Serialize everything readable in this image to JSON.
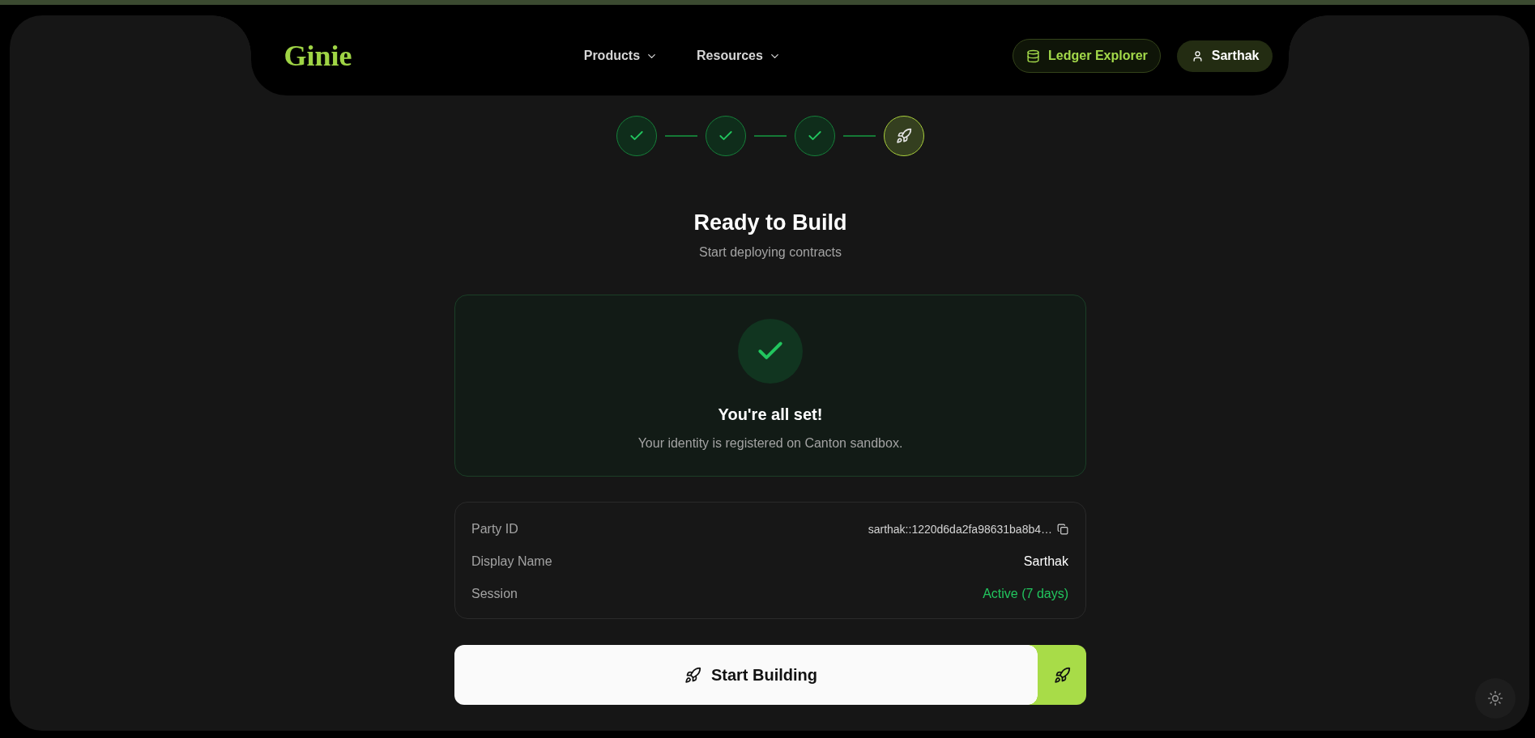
{
  "header": {
    "logo": "Ginie",
    "nav": [
      {
        "label": "Products"
      },
      {
        "label": "Resources"
      }
    ],
    "actions": [
      {
        "kind": "explorer",
        "label": "Ledger Explorer"
      },
      {
        "kind": "user",
        "label": "Sarthak"
      }
    ]
  },
  "steps": [
    {
      "completed": true
    },
    {
      "completed": true
    },
    {
      "completed": true
    },
    {
      "completed": false
    }
  ],
  "heading": {
    "title": "Ready to Build",
    "subtitle": "Start deploying contracts"
  },
  "status_card": {
    "title": "You're all set!",
    "message": "Your identity is registered on Canton sandbox."
  },
  "details": [
    {
      "kind": "copyable",
      "label": "Party ID",
      "value": "sarthak::1220d6da2fa98631ba8b4…"
    },
    {
      "kind": "plain",
      "label": "Display Name",
      "value": "Sarthak"
    },
    {
      "kind": "status",
      "label": "Session",
      "value": "Active (7 days)"
    }
  ],
  "primary_action": {
    "label": "Start Building"
  }
}
